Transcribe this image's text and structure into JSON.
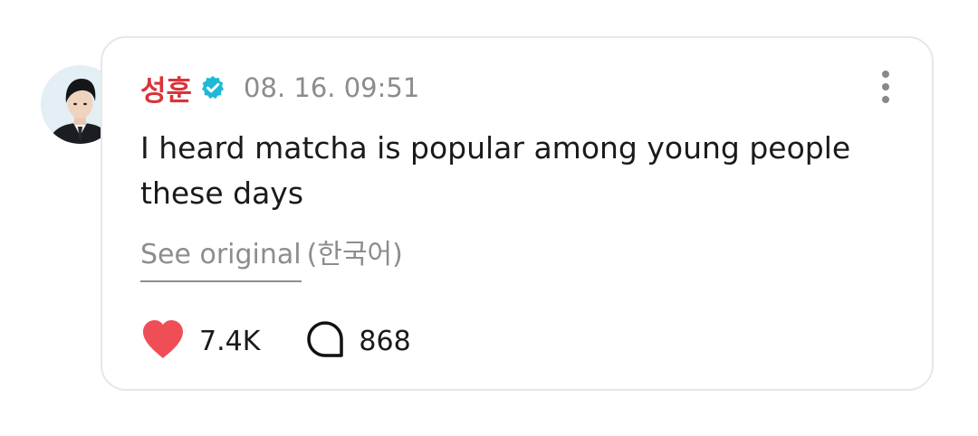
{
  "post": {
    "author": "성훈",
    "timestamp": "08. 16. 09:51",
    "text": "I heard matcha is popular among young people these days",
    "see_original": "See original",
    "original_language": "(한국어)",
    "likes": "7.4K",
    "comments": "868"
  },
  "colors": {
    "author_name": "#d9343a",
    "verified_badge": "#1fb8d6",
    "heart": "#f04e57"
  },
  "icons": {
    "avatar": "profile-photo",
    "verified": "verified-badge-icon",
    "more": "more-vertical-icon",
    "like": "heart-icon",
    "comment": "comment-bubble-icon"
  }
}
